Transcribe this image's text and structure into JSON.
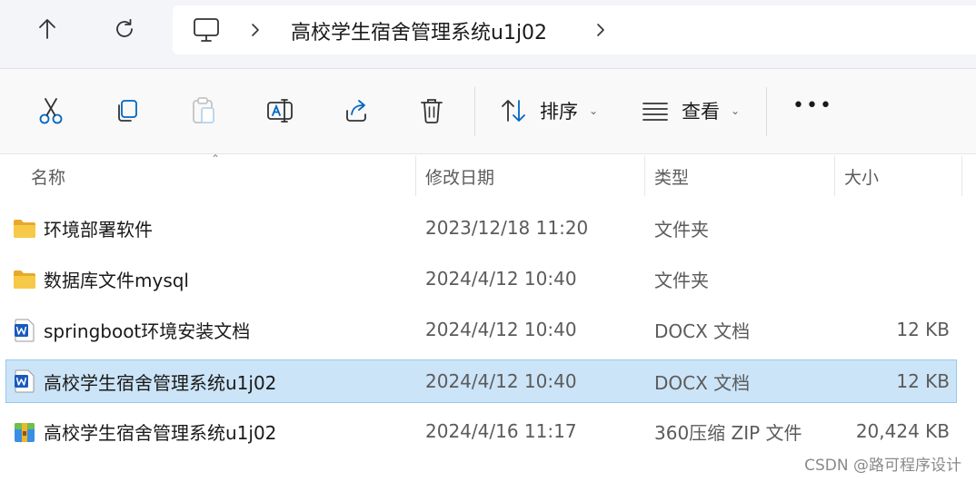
{
  "address_bar": {
    "breadcrumb": "高校学生宿舍管理系统u1j02"
  },
  "toolbar": {
    "sort_label": "排序",
    "view_label": "查看",
    "more_label": "•••"
  },
  "columns": {
    "name": "名称",
    "date": "修改日期",
    "type": "类型",
    "size": "大小"
  },
  "files": [
    {
      "name": "环境部署软件",
      "date": "2023/12/18 11:20",
      "type": "文件夹",
      "size": "",
      "icon": "folder-icon"
    },
    {
      "name": "数据库文件mysql",
      "date": "2024/4/12 10:40",
      "type": "文件夹",
      "size": "",
      "icon": "folder-icon"
    },
    {
      "name": "springboot环境安装文档",
      "date": "2024/4/12 10:40",
      "type": "DOCX 文档",
      "size": "12 KB",
      "icon": "word-doc-icon"
    },
    {
      "name": "高校学生宿舍管理系统u1j02",
      "date": "2024/4/12 10:40",
      "type": "DOCX 文档",
      "size": "12 KB",
      "icon": "word-doc-icon",
      "selected": true
    },
    {
      "name": "高校学生宿舍管理系统u1j02",
      "date": "2024/4/16 11:17",
      "type": "360压缩 ZIP 文件",
      "size": "20,424 KB",
      "icon": "zip-archive-icon"
    }
  ],
  "watermark": "CSDN @路可程序设计",
  "colors": {
    "selection": "#cce4f7",
    "folder": "#f7c244",
    "word": "#185abd",
    "accent": "#0067c0"
  }
}
